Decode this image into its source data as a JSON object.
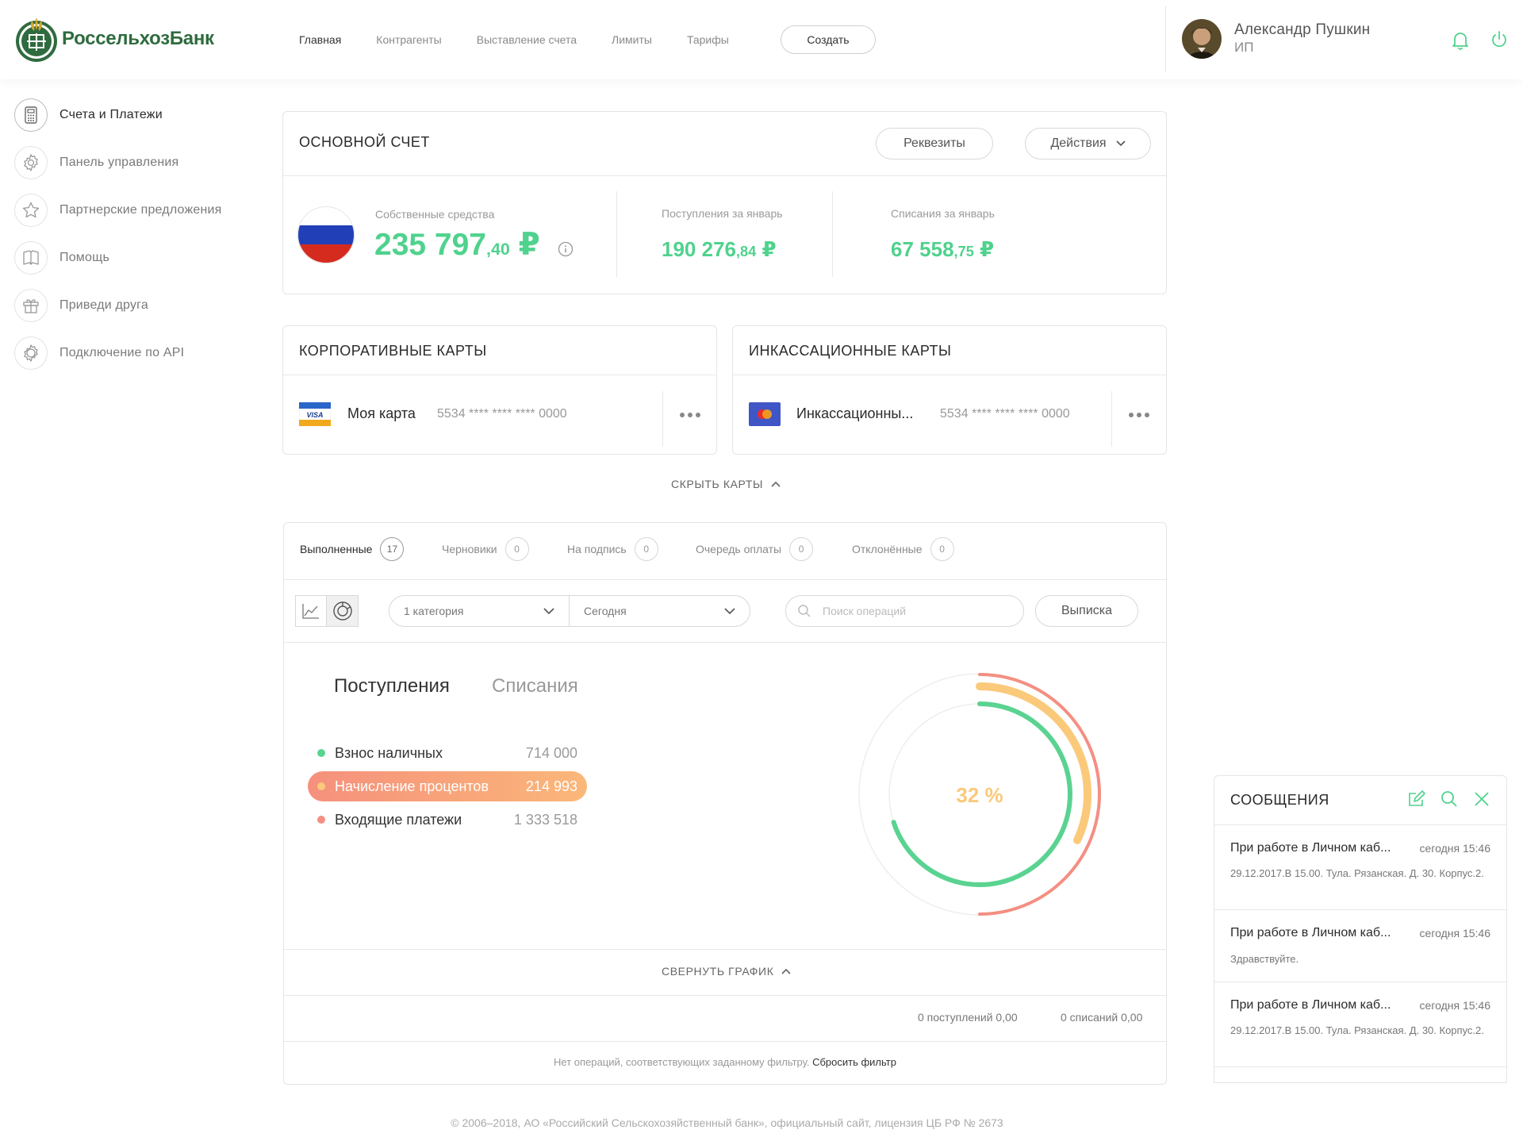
{
  "header": {
    "logo_text": "РоссельхозБанк",
    "nav": [
      {
        "label": "Главная",
        "active": true
      },
      {
        "label": "Контрагенты",
        "active": false
      },
      {
        "label": "Выставление счета",
        "active": false
      },
      {
        "label": "Лимиты",
        "active": false
      },
      {
        "label": "Тарифы",
        "active": false
      }
    ],
    "create_label": "Создать",
    "user_name": "Александр Пушкин",
    "user_role": "ИП"
  },
  "sidebar": {
    "items": [
      {
        "label": "Счета и Платежи",
        "icon": "calculator-icon",
        "active": true
      },
      {
        "label": "Панель управления",
        "icon": "gear-icon",
        "active": false
      },
      {
        "label": "Партнерские предложения",
        "icon": "star-icon",
        "active": false
      },
      {
        "label": "Помощь",
        "icon": "book-icon",
        "active": false
      },
      {
        "label": "Приведи друга",
        "icon": "gift-icon",
        "active": false
      },
      {
        "label": "Подключение по API",
        "icon": "api-gear-icon",
        "active": false
      }
    ]
  },
  "main_account": {
    "title": "ОСНОВНОЙ СЧЕТ",
    "requisites_label": "Реквезиты",
    "actions_label": "Действия",
    "own_funds_label": "Собственные средства",
    "own_funds_int": "235 797",
    "own_funds_cents": ",40",
    "own_funds_currency": " ₽",
    "income_label": "Поступления за январь",
    "income_int": "190 276",
    "income_cents": ",84",
    "income_currency": " ₽",
    "outgo_label": "Списания за январь",
    "outgo_int": "67 558",
    "outgo_cents": ",75",
    "outgo_currency": " ₽"
  },
  "corp_cards": {
    "title": "КОРПОРАТИВНЫЕ КАРТЫ",
    "card_brand": "VISA",
    "card_name": "Моя карта",
    "card_number": "5534 **** **** **** 0000"
  },
  "cash_cards": {
    "title": "ИНКАССАЦИОННЫЕ КАРТЫ",
    "card_name": "Инкассационны...",
    "card_number": "5534 **** **** **** 0000"
  },
  "hide_cards_label": "СКРЫТЬ КАРТЫ",
  "operations": {
    "tabs": [
      {
        "label": "Выполненные",
        "count": "17",
        "active": true
      },
      {
        "label": "Черновики",
        "count": "0",
        "active": false
      },
      {
        "label": "На подпись",
        "count": "0",
        "active": false
      },
      {
        "label": "Очередь оплаты",
        "count": "0",
        "active": false
      },
      {
        "label": "Отклонённые",
        "count": "0",
        "active": false
      }
    ],
    "category_select": "1 категория",
    "period_select": "Сегодня",
    "search_placeholder": "Поиск операций",
    "statement_label": "Выписка",
    "chart_tab_income": "Поступления",
    "chart_tab_outgo": "Списания",
    "collapse_chart_label": "СВЕРНУТЬ ГРАФИК",
    "totals_income": "0 поступлений 0,00",
    "totals_outgo": "0 списаний 0,00",
    "empty_text": "Нет операций, соответствующих заданному фильтру.",
    "reset_filter_label": "Сбросить фильтр"
  },
  "chart_data": {
    "type": "radial-bar",
    "center_label": "32 %",
    "series": [
      {
        "name": "Взнос наличных",
        "value": 714000,
        "display": "714 000",
        "color": "#5ad391",
        "arc_fraction": 0.7
      },
      {
        "name": "Начисление процентов",
        "value": 214993,
        "display": "214 993",
        "color": "#fbc97a",
        "arc_fraction": 0.32
      },
      {
        "name": "Входящие платежи",
        "value": 1333518,
        "display": "1 333 518",
        "color": "#f48f82",
        "arc_fraction": 0.5
      }
    ]
  },
  "messages": {
    "title": "СООБЩЕНИЯ",
    "items": [
      {
        "title": "При работе в Личном каб...",
        "time": "сегодня 15:46",
        "body": "29.12.2017.В 15.00. Тула. Рязанская. Д. 30. Корпус.2."
      },
      {
        "title": "При работе в Личном каб...",
        "time": "сегодня 15:46",
        "body": "Здравствуйте."
      },
      {
        "title": "При работе в Личном каб...",
        "time": "сегодня 15:46",
        "body": "29.12.2017.В 15.00. Тула. Рязанская. Д. 30. Корпус.2."
      }
    ]
  },
  "footer": "© 2006–2018, АО «Российский Сельскохозяйственный банк», официальный сайт, лицензия ЦБ РФ № 2673",
  "colors": {
    "accent_green": "#4fd28d",
    "brand_green": "#2f6b3f",
    "orange": "#fbc97a",
    "red": "#f48f82"
  }
}
